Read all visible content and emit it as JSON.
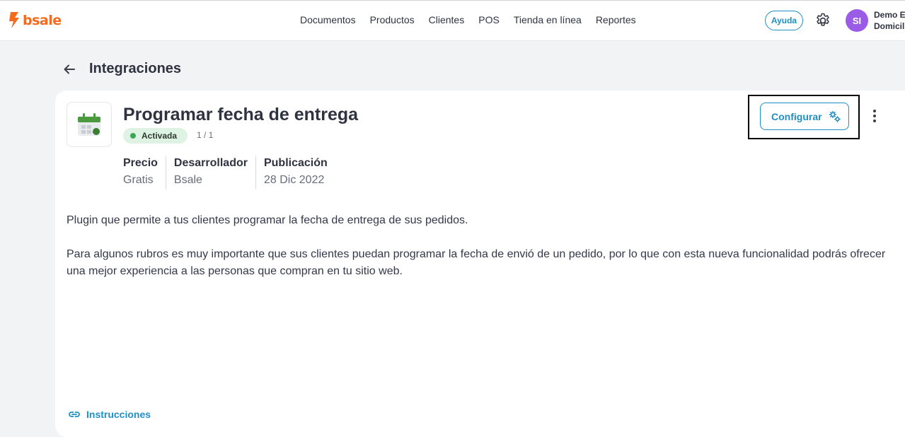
{
  "header": {
    "logo_text": "bsale",
    "nav": [
      "Documentos",
      "Productos",
      "Clientes",
      "POS",
      "Tienda en línea",
      "Reportes"
    ],
    "help_label": "Ayuda",
    "avatar_initials": "SI",
    "user_line1": "Demo E",
    "user_line2": "Domicil",
    "brand_color": "#f46a1f",
    "accent_color": "#1f8fc4"
  },
  "page": {
    "title": "Integraciones"
  },
  "integration": {
    "title": "Programar fecha de entrega",
    "status": "Activada",
    "status_color": "#3aa655",
    "counter": "1 / 1",
    "meta": [
      {
        "label": "Precio",
        "value": "Gratis"
      },
      {
        "label": "Desarrollador",
        "value": "Bsale"
      },
      {
        "label": "Publicación",
        "value": "28 Dic 2022"
      }
    ],
    "description": [
      "Plugin que permite a tus clientes programar la fecha de entrega de sus pedidos.",
      "Para algunos rubros es muy importante que sus clientes puedan programar la fecha de envió de un pedido, por lo que con esta nueva funcionalidad podrás ofrecer una mejor experiencia a las personas que compran en tu sitio web."
    ],
    "configure_label": "Configurar",
    "instructions_label": "Instrucciones"
  }
}
